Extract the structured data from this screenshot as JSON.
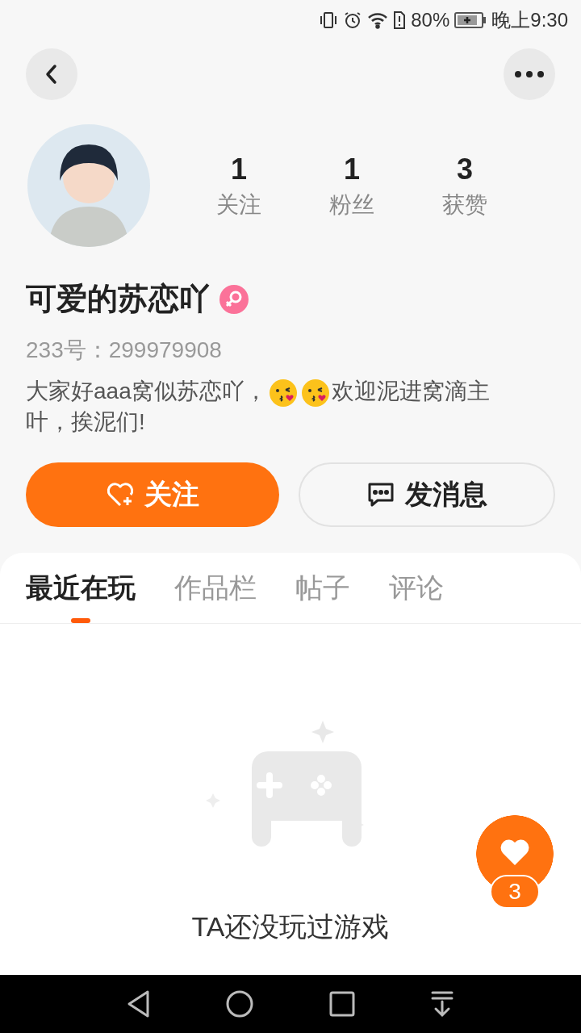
{
  "status_bar": {
    "battery": "80%",
    "time": "晚上9:30"
  },
  "stats": [
    {
      "value": "1",
      "label": "关注"
    },
    {
      "value": "1",
      "label": "粉丝"
    },
    {
      "value": "3",
      "label": "获赞"
    }
  ],
  "profile": {
    "name": "可爱的苏恋吖",
    "female": true,
    "id_text": "233号：299979908",
    "bio": [
      {
        "kind": "text",
        "text": "大家好aaa窝似苏恋吖，"
      },
      {
        "kind": "emoji"
      },
      {
        "kind": "emoji"
      },
      {
        "kind": "text",
        "text": "欢迎泥进窝滴主叶，挨泥们!"
      }
    ]
  },
  "actions": [
    {
      "label": "关注",
      "kind": "primary"
    },
    {
      "label": "发消息",
      "kind": "secondary"
    }
  ],
  "tabs": [
    {
      "label": "最近在玩",
      "selected": true
    },
    {
      "label": "作品栏",
      "selected": false
    },
    {
      "label": "帖子",
      "selected": false
    },
    {
      "label": "评论",
      "selected": false
    }
  ],
  "empty_state": {
    "message": "TA还没玩过游戏"
  },
  "like_button": {
    "count": "3"
  }
}
